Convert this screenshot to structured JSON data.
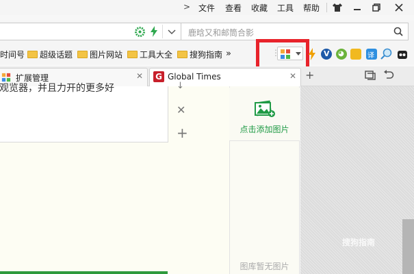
{
  "menubar": {
    "items": [
      "文件",
      "查看",
      "收藏",
      "工具",
      "帮助"
    ]
  },
  "addressbar": {
    "search_placeholder": "鹿晗又和邮筒合影"
  },
  "bookmarks": {
    "items": [
      "时间号",
      "超级话题",
      "图片网站",
      "工具大全",
      "搜狗指南"
    ]
  },
  "tabs": [
    {
      "label": "扩展管理"
    },
    {
      "label": "Global Times"
    }
  ],
  "content": {
    "cut_text": "观览器，并且力开的更多好",
    "add_image_label": "点击添加图片",
    "empty_gallery_label": "图库暂无图片"
  },
  "watermark": "搜狗指南",
  "colors": {
    "highlight_box": "#e8232b",
    "accent_green": "#1f9a45",
    "global_times_red": "#c8202b"
  }
}
